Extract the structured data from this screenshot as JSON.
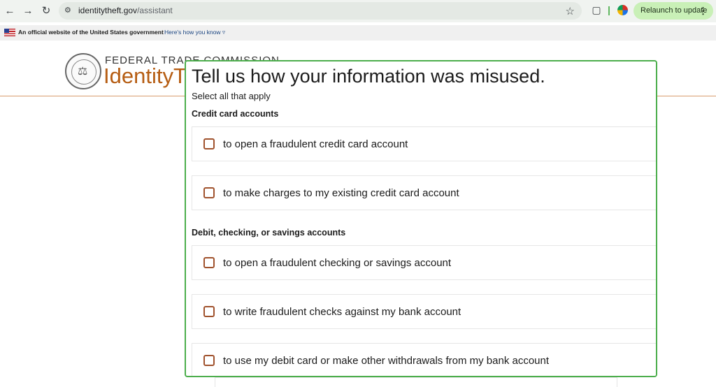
{
  "browser": {
    "url_domain": "identitytheft.gov",
    "url_path": "/assistant",
    "relaunch_label": "Relaunch to update"
  },
  "gov_banner": {
    "text": "An official website of the United States government",
    "link": "Here's how you know"
  },
  "header": {
    "agency": "FEDERAL TRADE COMMISSION",
    "brand": "IdentityTheft.gov"
  },
  "question": {
    "title": "Tell us how your information was misused.",
    "subtitle": "Select all that apply"
  },
  "sections": [
    {
      "label": "Credit card accounts",
      "options": [
        "to open a fraudulent credit card account",
        "to make charges to my existing credit card account"
      ]
    },
    {
      "label": "Debit, checking, or savings accounts",
      "options": [
        "to open a fraudulent checking or savings account",
        "to write fraudulent checks against my bank account",
        "to use my debit card or make other withdrawals from my bank account"
      ]
    }
  ],
  "colors": {
    "accent_green": "#4cae4c",
    "brand_orange": "#b65d13",
    "checkbox_border": "#a0522d"
  }
}
